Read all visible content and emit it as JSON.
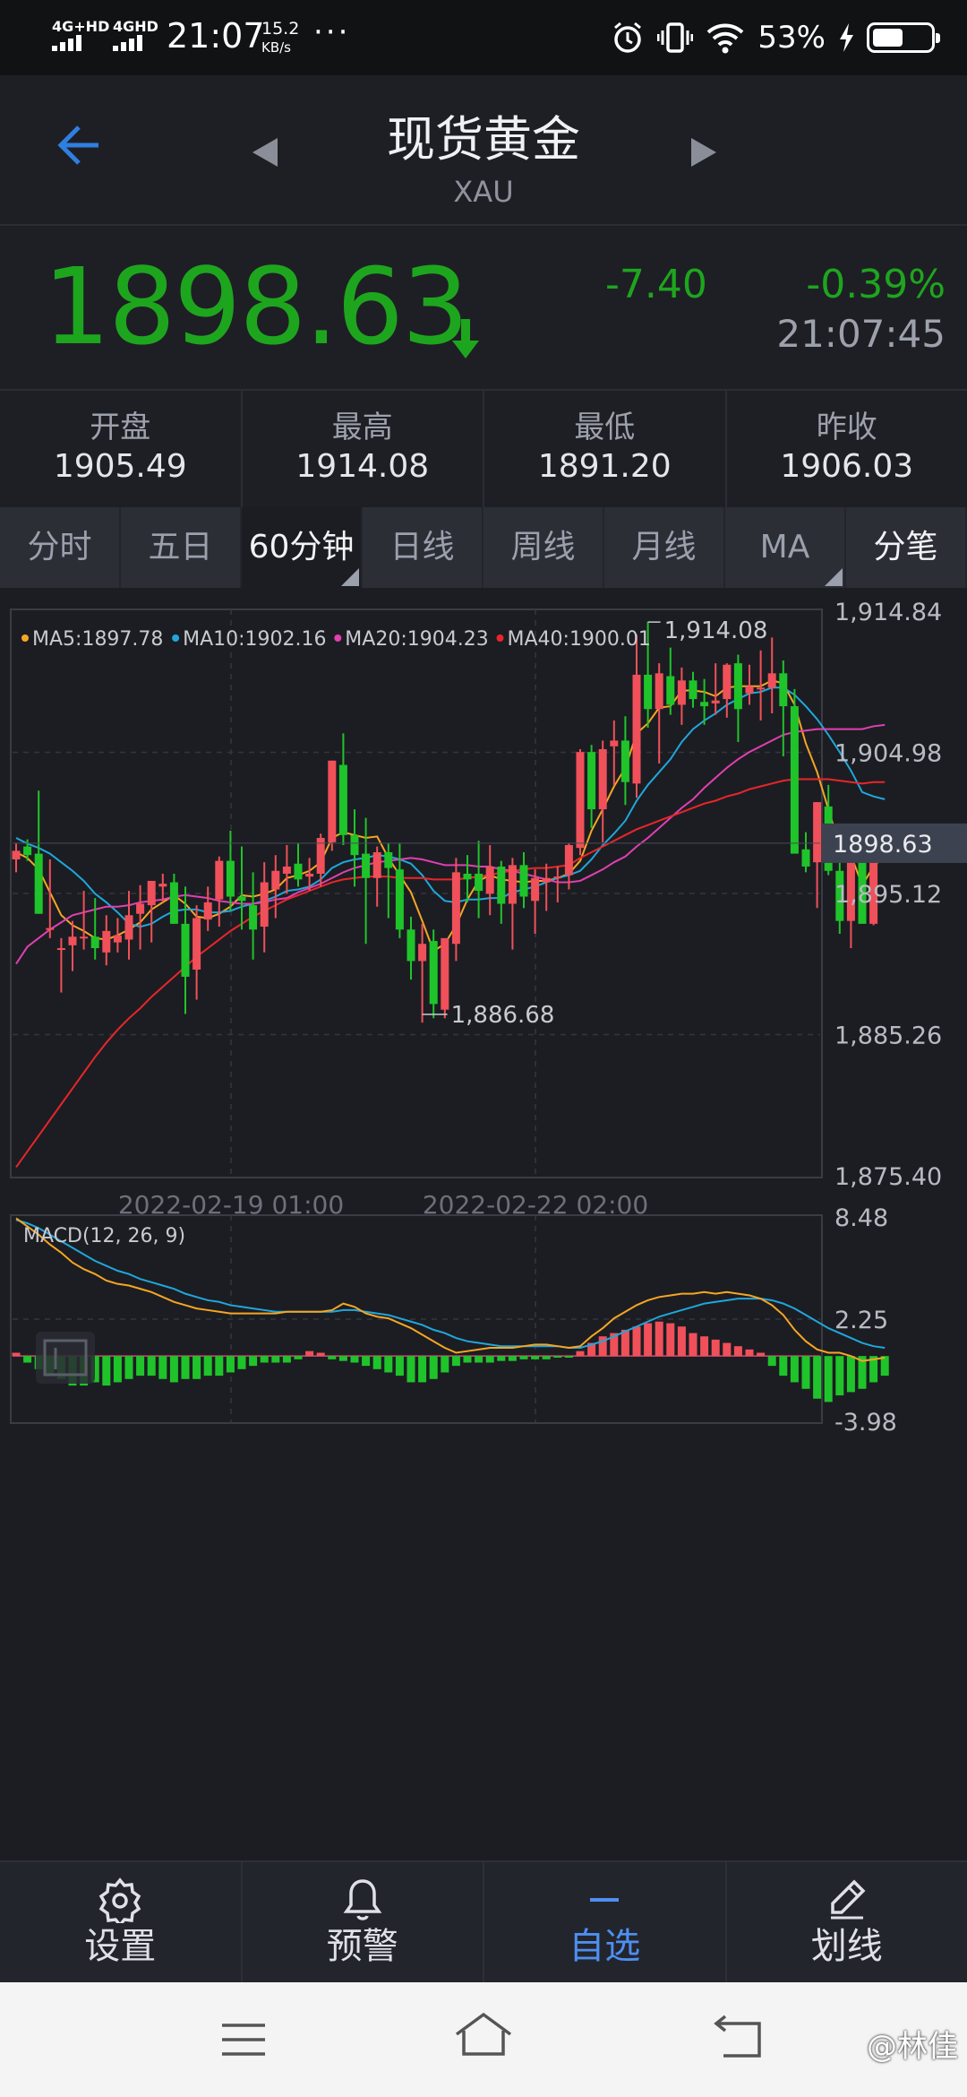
{
  "status_bar": {
    "network1": "4G+HD",
    "network2": "4GHD",
    "time": "21:07",
    "speed_value": "15.2",
    "speed_unit": "KB/s",
    "more": "···",
    "battery_pct": "53%",
    "battery_level": 0.53
  },
  "header": {
    "title": "现货黄金",
    "subtitle": "XAU"
  },
  "quote": {
    "price": "1898.63",
    "change": "-7.40",
    "change_pct": "-0.39%",
    "time": "21:07:45",
    "down_color": "#1ea51e"
  },
  "stats": [
    {
      "label": "开盘",
      "value": "1905.49"
    },
    {
      "label": "最高",
      "value": "1914.08"
    },
    {
      "label": "最低",
      "value": "1891.20"
    },
    {
      "label": "昨收",
      "value": "1906.03"
    }
  ],
  "tabs": [
    "分时",
    "五日",
    "60分钟",
    "日线",
    "周线",
    "月线",
    "MA",
    "分笔"
  ],
  "active_tab": "60分钟",
  "chart_data": {
    "type": "candlestick",
    "ma_legend": [
      {
        "label": "MA5:1897.78",
        "color": "#f5a623"
      },
      {
        "label": "MA10:1902.16",
        "color": "#1fa7dc"
      },
      {
        "label": "MA20:1904.23",
        "color": "#e040b0"
      },
      {
        "label": "MA40:1900.01",
        "color": "#e8262a"
      }
    ],
    "y_ticks": [
      "1,914.84",
      "1,904.98",
      "1,895.12",
      "1,885.26",
      "1,875.40"
    ],
    "ylim": [
      1875.4,
      1914.84
    ],
    "current_price_label": "1898.63",
    "current_price": 1898.63,
    "high_annotation": "1,914.08",
    "high_value": 1914.08,
    "low_annotation": "1,886.68",
    "low_value": 1886.68,
    "x_labels": [
      "2022-02-19 01:00",
      "2022-02-22 02:00"
    ],
    "up_color": "#f0505a",
    "down_color": "#1fc42a",
    "candles": [
      [
        1897.5,
        1898.6,
        1896.6,
        1898.1
      ],
      [
        1898.4,
        1898.9,
        1897.4,
        1897.8
      ],
      [
        1897.9,
        1902.3,
        1893.7,
        1893.7
      ],
      [
        1892.6,
        1897.5,
        1892.0,
        1892.7
      ],
      [
        1891.3,
        1892.0,
        1888.2,
        1891.3
      ],
      [
        1891.5,
        1893.2,
        1889.7,
        1892.1
      ],
      [
        1892.0,
        1895.3,
        1891.2,
        1892.1
      ],
      [
        1892.1,
        1894.8,
        1890.5,
        1891.3
      ],
      [
        1891.0,
        1893.6,
        1890.1,
        1892.5
      ],
      [
        1891.7,
        1893.4,
        1891.0,
        1892.2
      ],
      [
        1891.9,
        1895.3,
        1890.5,
        1893.6
      ],
      [
        1893.7,
        1895.7,
        1891.2,
        1894.4
      ],
      [
        1894.3,
        1896.0,
        1891.7,
        1896.0
      ],
      [
        1895.6,
        1896.5,
        1894.5,
        1895.8
      ],
      [
        1895.9,
        1896.5,
        1893.0,
        1893.0
      ],
      [
        1893.0,
        1895.6,
        1886.7,
        1889.3
      ],
      [
        1889.8,
        1894.3,
        1887.7,
        1893.4
      ],
      [
        1893.3,
        1895.6,
        1892.5,
        1894.5
      ],
      [
        1894.7,
        1897.7,
        1892.8,
        1897.4
      ],
      [
        1897.4,
        1899.5,
        1893.9,
        1894.9
      ],
      [
        1894.9,
        1898.4,
        1892.6,
        1894.6
      ],
      [
        1894.3,
        1896.6,
        1890.5,
        1892.6
      ],
      [
        1892.8,
        1897.3,
        1891.0,
        1895.9
      ],
      [
        1895.4,
        1897.8,
        1893.4,
        1896.7
      ],
      [
        1896.5,
        1898.5,
        1895.1,
        1897.0
      ],
      [
        1897.2,
        1898.6,
        1895.6,
        1896.1
      ],
      [
        1896.3,
        1897.6,
        1895.3,
        1896.5
      ],
      [
        1896.5,
        1899.3,
        1895.6,
        1899.0
      ],
      [
        1898.7,
        1904.4,
        1898.1,
        1904.4
      ],
      [
        1904.1,
        1906.3,
        1898.5,
        1899.2
      ],
      [
        1899.2,
        1901.0,
        1895.6,
        1897.8
      ],
      [
        1897.9,
        1900.4,
        1891.6,
        1896.2
      ],
      [
        1896.2,
        1898.4,
        1894.2,
        1898.0
      ],
      [
        1898.0,
        1898.6,
        1893.4,
        1896.9
      ],
      [
        1896.8,
        1898.6,
        1892.0,
        1892.6
      ],
      [
        1892.6,
        1893.5,
        1889.1,
        1890.4
      ],
      [
        1890.4,
        1893.0,
        1886.1,
        1891.6
      ],
      [
        1891.8,
        1892.6,
        1886.4,
        1887.4
      ],
      [
        1887.0,
        1891.2,
        1886.4,
        1892.0
      ],
      [
        1891.6,
        1897.6,
        1890.4,
        1896.6
      ],
      [
        1896.5,
        1897.8,
        1894.5,
        1896.1
      ],
      [
        1896.5,
        1898.8,
        1893.4,
        1895.3
      ],
      [
        1895.1,
        1898.5,
        1893.6,
        1897.0
      ],
      [
        1897.0,
        1897.4,
        1893.0,
        1894.4
      ],
      [
        1894.4,
        1897.6,
        1891.2,
        1897.1
      ],
      [
        1897.1,
        1898.0,
        1894.1,
        1894.9
      ],
      [
        1894.6,
        1896.8,
        1892.3,
        1896.2
      ],
      [
        1895.9,
        1897.2,
        1893.9,
        1896.2
      ],
      [
        1896.2,
        1897.0,
        1894.5,
        1896.3
      ],
      [
        1896.4,
        1898.6,
        1895.4,
        1898.5
      ],
      [
        1898.3,
        1905.2,
        1897.8,
        1905.0
      ],
      [
        1905.0,
        1905.5,
        1899.7,
        1901.0
      ],
      [
        1901.0,
        1905.8,
        1898.7,
        1905.2
      ],
      [
        1905.4,
        1907.2,
        1902.7,
        1905.8
      ],
      [
        1905.8,
        1907.5,
        1901.3,
        1902.9
      ],
      [
        1902.8,
        1913.2,
        1901.8,
        1910.4
      ],
      [
        1910.4,
        1914.1,
        1906.7,
        1908.0
      ],
      [
        1908.0,
        1911.2,
        1904.2,
        1910.5
      ],
      [
        1910.3,
        1912.3,
        1907.6,
        1908.3
      ],
      [
        1908.3,
        1910.9,
        1906.9,
        1910.0
      ],
      [
        1910.0,
        1910.6,
        1908.1,
        1908.7
      ],
      [
        1908.5,
        1910.1,
        1906.9,
        1908.2
      ],
      [
        1908.4,
        1911.2,
        1907.6,
        1908.6
      ],
      [
        1908.7,
        1911.2,
        1907.4,
        1911.1
      ],
      [
        1911.2,
        1911.8,
        1905.7,
        1908.0
      ],
      [
        1909.1,
        1911.1,
        1908.3,
        1909.6
      ],
      [
        1909.4,
        1912.1,
        1907.2,
        1909.5
      ],
      [
        1909.5,
        1913.0,
        1907.7,
        1910.5
      ],
      [
        1910.5,
        1911.4,
        1904.7,
        1908.2
      ],
      [
        1908.2,
        1909.4,
        1902.9,
        1897.9
      ],
      [
        1898.2,
        1899.4,
        1896.6,
        1897.0
      ],
      [
        1897.3,
        1901.5,
        1894.1,
        1901.5
      ],
      [
        1901.2,
        1902.7,
        1896.4,
        1896.7
      ],
      [
        1896.7,
        1898.6,
        1892.3,
        1893.2
      ],
      [
        1893.2,
        1897.4,
        1891.3,
        1897.4
      ],
      [
        1897.3,
        1899.7,
        1893.1,
        1893.0
      ],
      [
        1893.0,
        1895.6,
        1892.9,
        1899.5
      ],
      [
        1899.5,
        1900.0,
        1897.5,
        1899.5
      ]
    ],
    "ma_series": [
      {
        "name": "MA5",
        "color": "#f5a623",
        "values": [
          1898.0,
          1897.6,
          1896.8,
          1895.2,
          1893.6,
          1892.9,
          1892.5,
          1892.0,
          1891.9,
          1892.2,
          1892.6,
          1893.1,
          1894.0,
          1894.5,
          1895.0,
          1894.4,
          1893.5,
          1893.4,
          1893.7,
          1894.2,
          1895.0,
          1894.9,
          1895.1,
          1895.4,
          1896.2,
          1896.4,
          1896.7,
          1897.3,
          1899.0,
          1899.4,
          1899.2,
          1899.0,
          1899.1,
          1897.6,
          1896.4,
          1895.2,
          1893.2,
          1891.1,
          1891.6,
          1892.9,
          1894.7,
          1896.0,
          1896.4,
          1896.1,
          1896.0,
          1895.9,
          1896.0,
          1896.0,
          1896.2,
          1896.5,
          1897.4,
          1899.5,
          1901.0,
          1902.6,
          1903.9,
          1906.3,
          1907.0,
          1908.1,
          1908.2,
          1909.3,
          1909.3,
          1909.2,
          1908.9,
          1909.5,
          1909.6,
          1909.6,
          1909.6,
          1910.0,
          1909.8,
          1908.3,
          1905.6,
          1903.6,
          1901.0,
          1898.4,
          1897.8,
          1895.7,
          1897.0,
          1897.8
        ]
      },
      {
        "name": "MA10",
        "color": "#1fa7dc",
        "values": [
          1899.0,
          1898.6,
          1898.3,
          1897.9,
          1897.3,
          1896.7,
          1896.0,
          1895.1,
          1894.5,
          1893.8,
          1893.0,
          1892.8,
          1893.0,
          1893.5,
          1893.9,
          1894.0,
          1894.0,
          1893.8,
          1893.8,
          1893.9,
          1894.2,
          1894.4,
          1894.6,
          1894.9,
          1895.3,
          1895.4,
          1895.6,
          1896.1,
          1896.9,
          1897.3,
          1897.5,
          1897.6,
          1897.8,
          1897.7,
          1897.5,
          1897.2,
          1896.4,
          1895.3,
          1894.6,
          1894.5,
          1894.7,
          1894.7,
          1894.8,
          1894.8,
          1895.2,
          1895.4,
          1895.6,
          1895.9,
          1896.2,
          1896.4,
          1896.7,
          1897.5,
          1898.5,
          1899.3,
          1900.2,
          1901.6,
          1902.7,
          1903.6,
          1904.5,
          1905.7,
          1906.6,
          1907.2,
          1907.7,
          1908.3,
          1908.7,
          1909.1,
          1909.2,
          1909.5,
          1909.5,
          1909.0,
          1908.2,
          1907.3,
          1906.2,
          1905.0,
          1903.7,
          1902.2,
          1901.9,
          1901.7
        ]
      },
      {
        "name": "MA20",
        "color": "#e040b0",
        "values": [
          1890.2,
          1891.4,
          1892.0,
          1892.6,
          1893.1,
          1893.6,
          1893.8,
          1894.0,
          1894.2,
          1894.2,
          1894.3,
          1894.5,
          1894.6,
          1894.7,
          1894.9,
          1895.0,
          1894.9,
          1894.8,
          1894.6,
          1894.5,
          1894.4,
          1894.4,
          1894.5,
          1894.7,
          1894.8,
          1895.2,
          1895.5,
          1895.8,
          1896.2,
          1896.6,
          1896.9,
          1897.1,
          1897.3,
          1897.4,
          1897.5,
          1897.6,
          1897.5,
          1897.3,
          1897.1,
          1897.1,
          1897.1,
          1897.0,
          1897.0,
          1896.8,
          1896.7,
          1896.5,
          1896.3,
          1896.1,
          1895.9,
          1895.9,
          1896.0,
          1896.4,
          1896.8,
          1897.3,
          1897.7,
          1898.4,
          1899.0,
          1899.7,
          1900.4,
          1901.1,
          1901.7,
          1902.5,
          1903.2,
          1903.9,
          1904.5,
          1905.0,
          1905.4,
          1905.8,
          1906.2,
          1906.4,
          1906.5,
          1906.6,
          1906.6,
          1906.6,
          1906.6,
          1906.6,
          1906.8,
          1906.9
        ]
      },
      {
        "name": "MA40",
        "color": "#e8262a",
        "values": [
          1876.0,
          1877.1,
          1878.2,
          1879.3,
          1880.4,
          1881.5,
          1882.6,
          1883.7,
          1884.7,
          1885.6,
          1886.4,
          1887.1,
          1887.9,
          1888.6,
          1889.3,
          1890.0,
          1890.7,
          1891.3,
          1891.9,
          1892.5,
          1893.0,
          1893.5,
          1893.9,
          1894.3,
          1894.7,
          1895.0,
          1895.3,
          1895.6,
          1895.9,
          1896.1,
          1896.2,
          1896.3,
          1896.3,
          1896.3,
          1896.2,
          1896.2,
          1896.2,
          1896.1,
          1896.1,
          1896.1,
          1896.2,
          1896.3,
          1896.4,
          1896.6,
          1896.7,
          1896.8,
          1896.9,
          1896.9,
          1897.0,
          1897.1,
          1897.6,
          1898.0,
          1898.4,
          1898.8,
          1899.2,
          1899.6,
          1899.9,
          1900.2,
          1900.5,
          1900.8,
          1901.1,
          1901.4,
          1901.6,
          1901.9,
          1902.1,
          1902.4,
          1902.6,
          1902.8,
          1903.0,
          1903.1,
          1903.1,
          1903.1,
          1903.1,
          1903.0,
          1902.9,
          1902.8,
          1902.9,
          1902.9
        ]
      }
    ],
    "macd": {
      "label": "MACD(12, 26, 9)",
      "y_ticks": [
        "8.48",
        "2.25",
        "-3.98"
      ],
      "ylim": [
        -3.98,
        8.48
      ],
      "dif": [
        8.4,
        7.9,
        7.4,
        6.8,
        6.3,
        5.7,
        5.3,
        5.0,
        4.6,
        4.4,
        4.3,
        4.1,
        3.9,
        3.6,
        3.3,
        3.1,
        2.9,
        2.8,
        2.7,
        2.6,
        2.6,
        2.6,
        2.6,
        2.6,
        2.7,
        2.7,
        2.7,
        2.7,
        2.8,
        3.2,
        3.0,
        2.6,
        2.4,
        2.3,
        2.0,
        1.7,
        1.3,
        0.9,
        0.5,
        0.2,
        0.3,
        0.4,
        0.5,
        0.5,
        0.5,
        0.6,
        0.7,
        0.7,
        0.6,
        0.5,
        0.6,
        1.2,
        1.7,
        2.3,
        2.7,
        3.1,
        3.4,
        3.6,
        3.7,
        3.8,
        3.8,
        3.9,
        3.8,
        3.9,
        3.8,
        3.7,
        3.5,
        3.1,
        2.5,
        1.6,
        0.9,
        0.4,
        0.2,
        0.2,
        0.0,
        -0.3,
        -0.2,
        -0.1
      ],
      "dea": [
        8.3,
        8.1,
        7.8,
        7.4,
        7.0,
        6.6,
        6.2,
        5.8,
        5.5,
        5.2,
        5.0,
        4.7,
        4.5,
        4.3,
        4.1,
        3.8,
        3.6,
        3.4,
        3.3,
        3.1,
        3.0,
        2.9,
        2.8,
        2.7,
        2.7,
        2.7,
        2.7,
        2.7,
        2.7,
        2.8,
        2.8,
        2.7,
        2.6,
        2.5,
        2.3,
        2.1,
        1.9,
        1.6,
        1.4,
        1.1,
        0.9,
        0.8,
        0.7,
        0.6,
        0.6,
        0.6,
        0.6,
        0.6,
        0.6,
        0.5,
        0.5,
        0.7,
        0.9,
        1.2,
        1.5,
        1.8,
        2.1,
        2.4,
        2.6,
        2.8,
        3.0,
        3.2,
        3.3,
        3.4,
        3.5,
        3.5,
        3.5,
        3.4,
        3.2,
        2.9,
        2.5,
        2.1,
        1.7,
        1.4,
        1.1,
        0.8,
        0.6,
        0.5
      ],
      "hist": [
        0.2,
        -0.4,
        -0.8,
        -1.2,
        -1.4,
        -1.8,
        -1.8,
        -1.6,
        -1.8,
        -1.6,
        -1.4,
        -1.2,
        -1.2,
        -1.4,
        -1.6,
        -1.4,
        -1.4,
        -1.2,
        -1.2,
        -1.0,
        -0.8,
        -0.6,
        -0.4,
        -0.4,
        -0.4,
        -0.2,
        0.3,
        0.2,
        -0.2,
        -0.3,
        -0.4,
        -0.6,
        -0.8,
        -1.0,
        -1.2,
        -1.6,
        -1.6,
        -1.4,
        -1.0,
        -0.6,
        -0.4,
        -0.4,
        -0.4,
        -0.3,
        -0.3,
        -0.2,
        -0.2,
        -0.2,
        -0.1,
        -0.1,
        0.3,
        0.8,
        1.2,
        1.4,
        1.6,
        1.8,
        2.0,
        2.1,
        2.0,
        1.8,
        1.4,
        1.2,
        1.0,
        0.8,
        0.6,
        0.4,
        0.2,
        -0.6,
        -1.2,
        -1.6,
        -2.0,
        -2.6,
        -2.8,
        -2.4,
        -2.2,
        -2.0,
        -1.6,
        -1.2
      ]
    }
  },
  "bottom_nav": [
    {
      "label": "设置",
      "icon": "gear-icon"
    },
    {
      "label": "预警",
      "icon": "bell-icon"
    },
    {
      "label": "自选",
      "icon": "minus-icon"
    },
    {
      "label": "划线",
      "icon": "pen-icon"
    }
  ],
  "watermark": "@林佳"
}
